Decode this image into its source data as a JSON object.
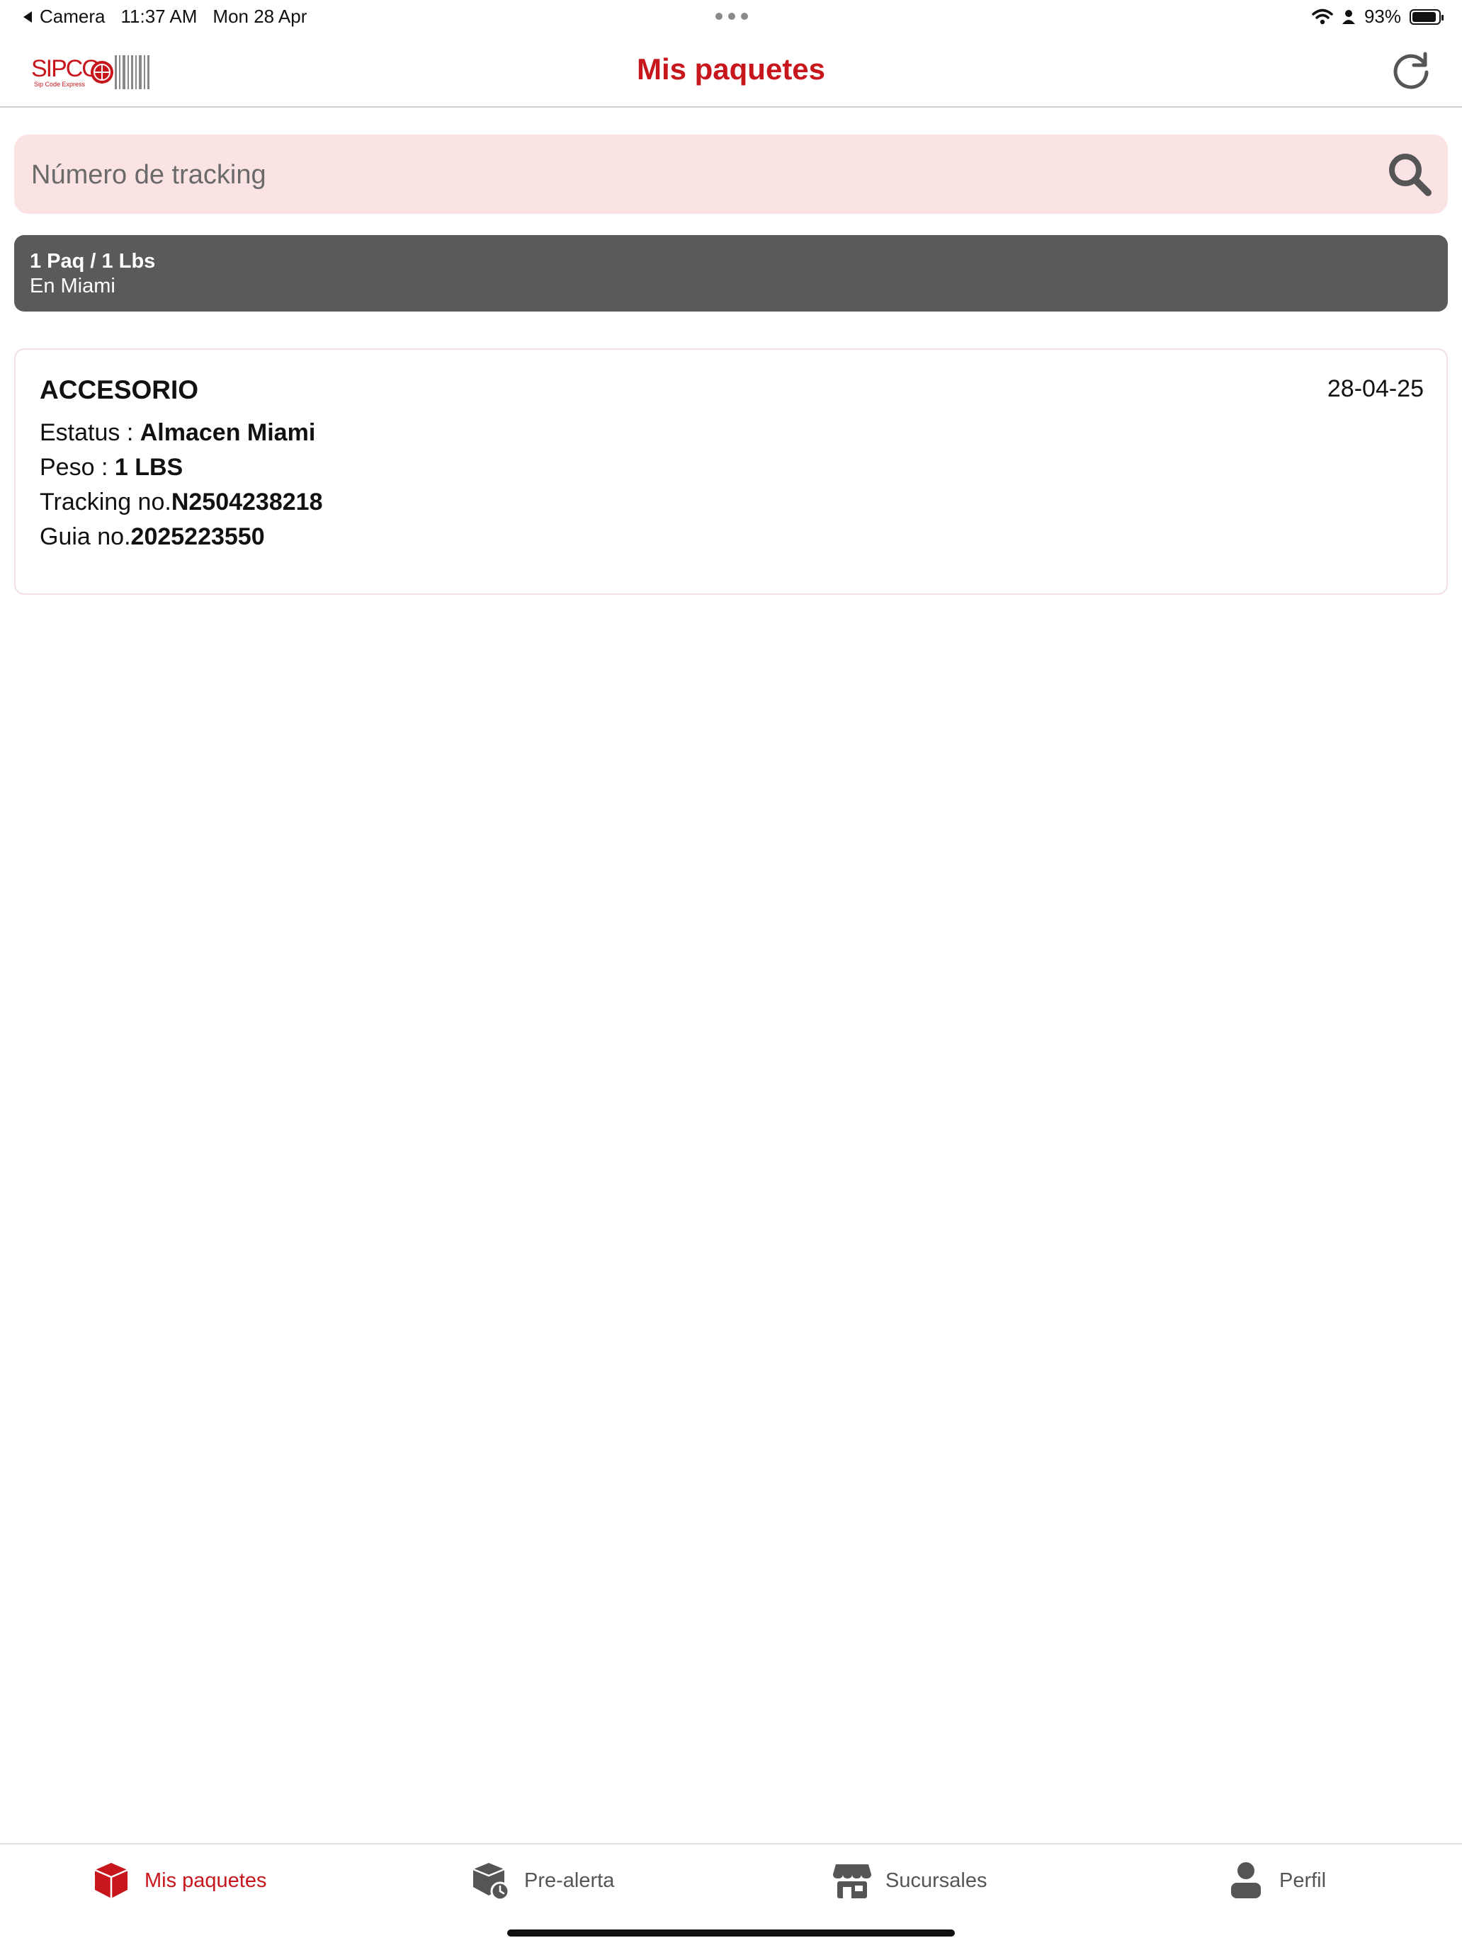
{
  "status_bar": {
    "back_app": "Camera",
    "time": "11:37 AM",
    "date": "Mon 28 Apr",
    "battery": "93%",
    "battery_level": 0.93
  },
  "header": {
    "logo_icon": "sipco-logo",
    "title": "Mis paquetes",
    "refresh_icon": "refresh-icon"
  },
  "search": {
    "placeholder": "Número de tracking",
    "value": "",
    "icon": "search-icon"
  },
  "summary": {
    "line1": "1 Paq / 1 Lbs",
    "line2": "En Miami"
  },
  "packages": [
    {
      "name": "ACCESORIO",
      "date": "28-04-25",
      "status_label": "Estatus : ",
      "status_value": "Almacen Miami",
      "weight_label": "Peso : ",
      "weight_value": "1 LBS",
      "tracking_label": "Tracking no.",
      "tracking_value": "N2504238218",
      "guide_label": "Guia no.",
      "guide_value": "2025223550"
    }
  ],
  "tabs": [
    {
      "label": "Mis paquetes",
      "icon": "package-icon",
      "active": true
    },
    {
      "label": "Pre-alerta",
      "icon": "package-clock-icon",
      "active": false
    },
    {
      "label": "Sucursales",
      "icon": "store-icon",
      "active": false
    },
    {
      "label": "Perfil",
      "icon": "user-icon",
      "active": false
    }
  ],
  "colors": {
    "accent": "#c8161d",
    "search_bg": "#fbe3e4",
    "summary_bg": "#5a5a5a",
    "tab_inactive": "#555555"
  }
}
